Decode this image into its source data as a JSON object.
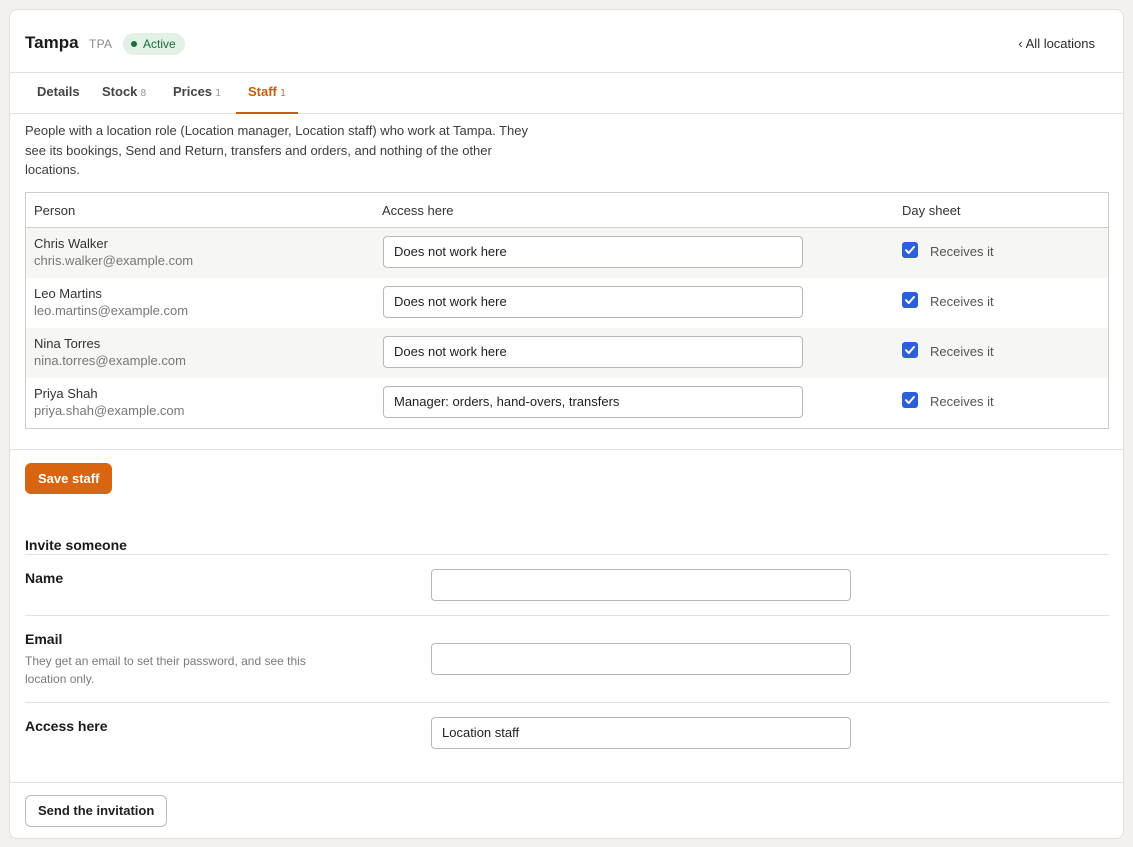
{
  "header": {
    "title": "Tampa",
    "code": "TPA",
    "status": "Active",
    "back_link": "‹ All locations"
  },
  "tabs": [
    {
      "label": "Details",
      "count": ""
    },
    {
      "label": "Stock",
      "count": "8"
    },
    {
      "label": "Prices",
      "count": "1"
    },
    {
      "label": "Staff",
      "count": "1"
    }
  ],
  "intro": "People with a location role (Location manager, Location staff) who work at Tampa. They see its bookings, Send and Return, transfers and orders, and nothing of the other locations.",
  "table": {
    "headers": {
      "person": "Person",
      "access": "Access here",
      "day_sheet": "Day sheet"
    },
    "rows": [
      {
        "name": "Chris Walker",
        "email": "chris.walker@example.com",
        "access": "Does not work here",
        "day_sheet": "Receives it"
      },
      {
        "name": "Leo Martins",
        "email": "leo.martins@example.com",
        "access": "Does not work here",
        "day_sheet": "Receives it"
      },
      {
        "name": "Nina Torres",
        "email": "nina.torres@example.com",
        "access": "Does not work here",
        "day_sheet": "Receives it"
      },
      {
        "name": "Priya Shah",
        "email": "priya.shah@example.com",
        "access": "Manager: orders, hand-overs, transfers",
        "day_sheet": "Receives it"
      }
    ]
  },
  "save_button": "Save staff",
  "invite": {
    "heading": "Invite someone",
    "name_label": "Name",
    "name_value": "",
    "email_label": "Email",
    "email_hint": "They get an email to set their password, and see this location only.",
    "email_value": "",
    "access_label": "Access here",
    "access_value": "Location staff"
  },
  "send_button": "Send the invitation",
  "colors": {
    "accent": "#d8650f",
    "active_tab": "#c25e0e",
    "badge_bg": "#e2f1e6",
    "badge_text": "#1f6b3a",
    "checkbox": "#2b5fd9"
  }
}
